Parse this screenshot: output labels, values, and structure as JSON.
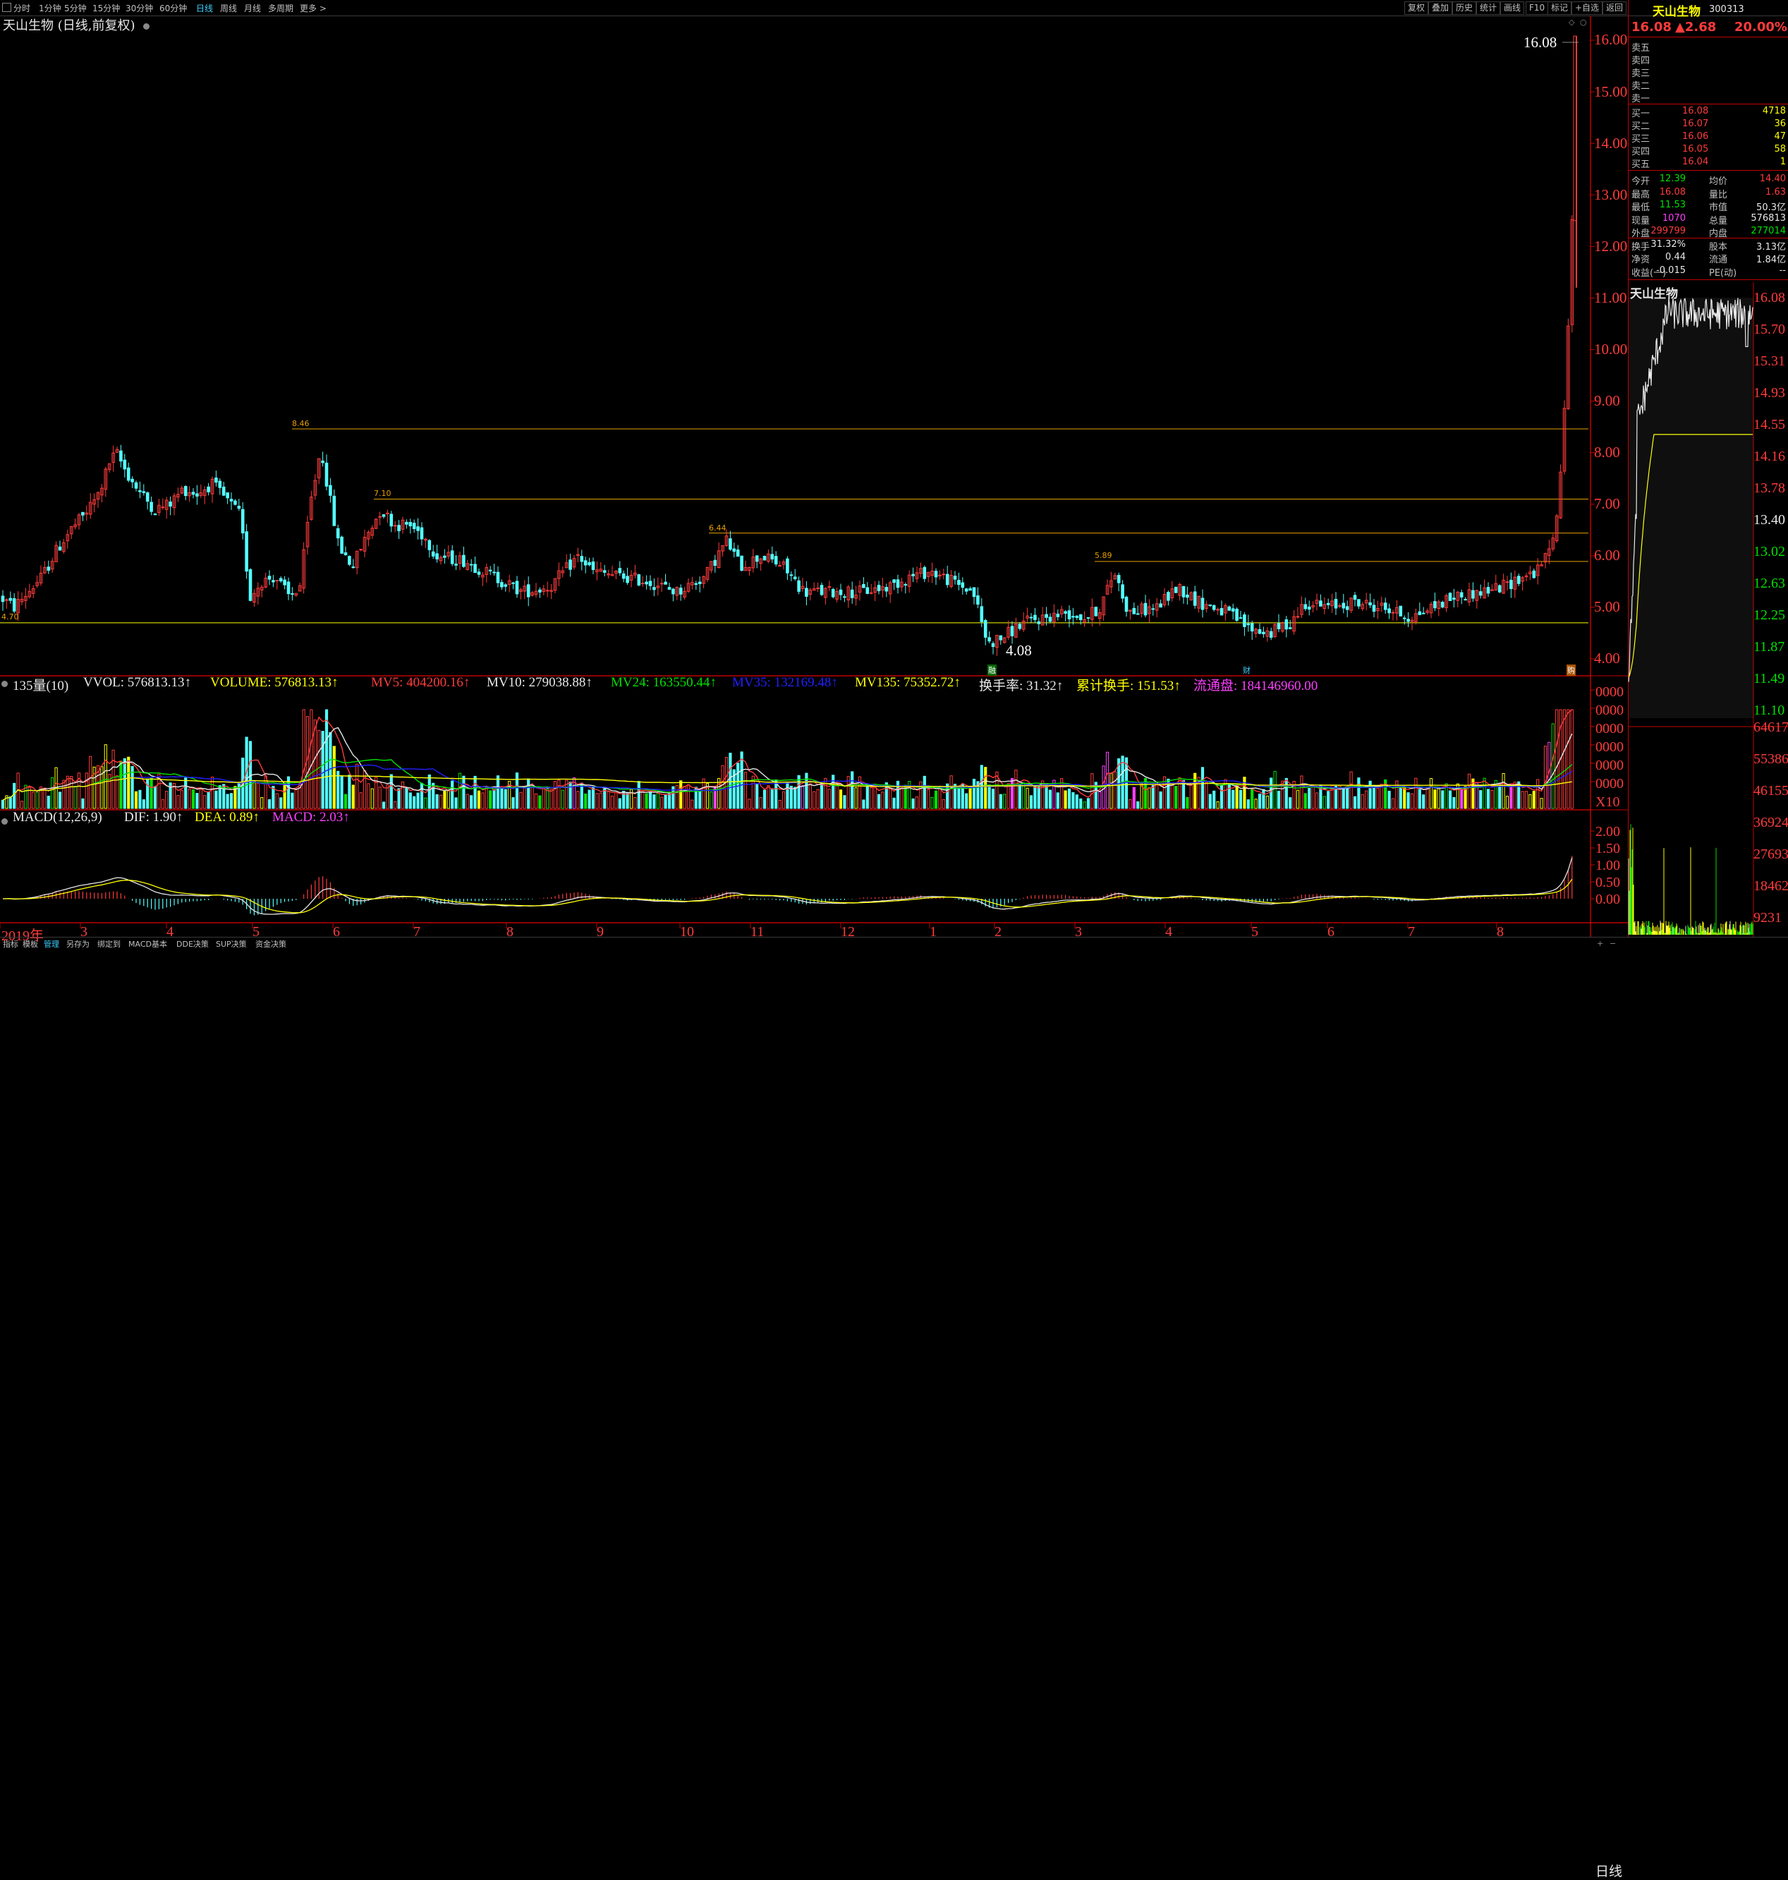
{
  "toolbar": {
    "periods": [
      "分时",
      "1分钟",
      "5分钟",
      "15分钟",
      "30分钟",
      "60分钟",
      "日线",
      "周线",
      "月线",
      "多周期",
      "更多 >"
    ],
    "active_period": "日线",
    "right_buttons": [
      "复权",
      "叠加",
      "历史",
      "统计",
      "画线",
      "F10",
      "标记",
      "+自选",
      "返回"
    ]
  },
  "chart": {
    "title": "天山生物 (日线,前复权)",
    "y_labels": [
      "16.00",
      "15.00",
      "14.00",
      "13.00",
      "12.00",
      "11.00",
      "10.00",
      "9.00",
      "8.00",
      "7.00",
      "6.00",
      "5.00",
      "4.00"
    ],
    "level_labels": [
      "8.46",
      "7.10",
      "6.44",
      "5.89",
      "4.70"
    ],
    "high_label": "16.08",
    "low_label": "4.08",
    "markers": [
      "融",
      "财",
      "购"
    ],
    "x_labels": [
      "2019年",
      "3",
      "4",
      "5",
      "6",
      "7",
      "8",
      "9",
      "10",
      "11",
      "12",
      "1",
      "2",
      "3",
      "4",
      "5",
      "6",
      "7",
      "8"
    ],
    "colors": {
      "up": "#ff3b3b",
      "down": "#54ffff",
      "level": "#e8a000",
      "baseline": "#ffff00"
    }
  },
  "volume": {
    "prefix": "135量(10)",
    "vvol": "VVOL: 576813.13↑",
    "volume": "VOLUME: 576813.13↑",
    "mv5": "MV5: 404200.16↑",
    "mv10": "MV10: 279038.88↑",
    "mv24": "MV24: 163550.44↑",
    "mv35": "MV35: 132169.48↑",
    "mv135": "MV135: 75352.72↑",
    "turnover": "换手率: 31.32↑",
    "cum_turnover": "累计换手: 151.53↑",
    "float": "流通盘: 184146960.00",
    "y_labels": [
      "0000",
      "0000",
      "0000",
      "0000",
      "0000",
      "0000",
      "0000",
      "X10"
    ]
  },
  "macd": {
    "label": "MACD(12,26,9)",
    "dif": "DIF: 1.90↑",
    "dea": "DEA: 0.89↑",
    "macd": "MACD: 2.03↑",
    "y_labels": [
      "2.00",
      "1.50",
      "1.00",
      "0.50",
      "0.00"
    ]
  },
  "bottom_tabs": [
    "指标",
    "模板",
    "管理",
    "另存为",
    "绑定到",
    "MACD基本",
    "DDE决策",
    "SUP决策",
    "资金决策"
  ],
  "bottom_active": "管理",
  "bottom_right": "日线",
  "panel": {
    "name": "天山生物",
    "code": "300313",
    "price": "16.08",
    "change": "▲2.68",
    "pct": "20.00%",
    "sells": [
      "卖五",
      "卖四",
      "卖三",
      "卖二",
      "卖一"
    ],
    "buys": [
      {
        "label": "买一",
        "price": "16.08",
        "vol": "4718"
      },
      {
        "label": "买二",
        "price": "16.07",
        "vol": "36"
      },
      {
        "label": "买三",
        "price": "16.06",
        "vol": "47"
      },
      {
        "label": "买四",
        "price": "16.05",
        "vol": "58"
      },
      {
        "label": "买五",
        "price": "16.04",
        "vol": "1"
      }
    ],
    "stats": [
      {
        "l1": "今开",
        "v1": "12.39",
        "c1": "grn",
        "l2": "均价",
        "v2": "14.40",
        "c2": "red"
      },
      {
        "l1": "最高",
        "v1": "16.08",
        "c1": "red",
        "l2": "量比",
        "v2": "1.63",
        "c2": "red"
      },
      {
        "l1": "最低",
        "v1": "11.53",
        "c1": "grn",
        "l2": "市值",
        "v2": "50.3亿",
        "c2": "wht"
      },
      {
        "l1": "现量",
        "v1": "1070",
        "c1": "mag",
        "l2": "总量",
        "v2": "576813",
        "c2": "wht"
      },
      {
        "l1": "外盘",
        "v1": "299799",
        "c1": "red",
        "l2": "内盘",
        "v2": "277014",
        "c2": "grn"
      },
      {
        "l1": "换手",
        "v1": "31.32%",
        "c1": "wht",
        "l2": "股本",
        "v2": "3.13亿",
        "c2": "wht"
      },
      {
        "l1": "净资",
        "v1": "0.44",
        "c1": "wht",
        "l2": "流通",
        "v2": "1.84亿",
        "c2": "wht"
      },
      {
        "l1": "收益(一)",
        "v1": "-0.015",
        "c1": "wht",
        "l2": "PE(动)",
        "v2": "--",
        "c2": "wht"
      }
    ],
    "mini_title": "天山生物",
    "mini_prices": [
      {
        "v": "16.08",
        "c": "#ff3b3b"
      },
      {
        "v": "15.70",
        "c": "#ff3b3b"
      },
      {
        "v": "15.31",
        "c": "#ff3b3b"
      },
      {
        "v": "14.93",
        "c": "#ff3b3b"
      },
      {
        "v": "14.55",
        "c": "#ff3b3b"
      },
      {
        "v": "14.16",
        "c": "#ff3b3b"
      },
      {
        "v": "13.78",
        "c": "#ff3b3b"
      },
      {
        "v": "13.40",
        "c": "#e8e8e8"
      },
      {
        "v": "13.02",
        "c": "#00e000"
      },
      {
        "v": "12.63",
        "c": "#00e000"
      },
      {
        "v": "12.25",
        "c": "#00e000"
      },
      {
        "v": "11.87",
        "c": "#00e000"
      },
      {
        "v": "11.49",
        "c": "#00e000"
      },
      {
        "v": "11.10",
        "c": "#00e000"
      }
    ],
    "mini_vols": [
      "64617",
      "55386",
      "46155",
      "36924",
      "27693",
      "18462",
      "9231"
    ]
  }
}
